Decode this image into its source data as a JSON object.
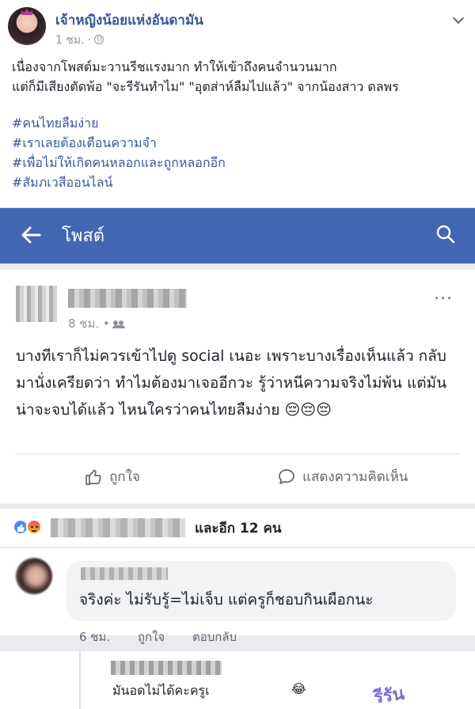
{
  "outer_post": {
    "author": "เจ้าหญิงน้อยแห่งอันดามัน",
    "time": "1 ชม.",
    "dot": "·",
    "privacy_icon": "globe-icon",
    "text_line1": "เนื่องจากโพสต์มะวานรีชแรงมาก ทำให้เข้าถึงคนจำนวนมาก",
    "text_line2": "แต่ก็มีเสียงตัดพ้อ \"จะรีรันทำไม\" \"อุตส่าห์ลืมไปแล้ว\" จากน้องสาว ดลพร",
    "hashtags": [
      "#คนไทยลืมง่าย",
      "#เราเลยต้องเตือนความจำ",
      "#เพื่อไม่ให้เกิดคนหลอกและถูกหลอกอีก",
      "#สัมภเวสีออนไลน์"
    ]
  },
  "appbar": {
    "title": "โพสต์",
    "back_icon": "back-arrow-icon",
    "search_icon": "search-icon",
    "color": "#4267b2"
  },
  "inner_post": {
    "time": "8 ชม. •",
    "more": "...",
    "body": "บางทีเราก็ไม่ควรเข้าไปดู social เนอะ เพราะบางเรื่องเห็นแล้ว กลับมานั่งเครียดว่า ทำไมต้องมาเจออีกวะ รู้ว่าหนีความจริงไม่พ้น แต่มันน่าจะจบได้แล้ว ไหนใครว่าคนไทยลืมง่าย 😔😔😔",
    "like_label": "ถูกใจ",
    "comment_label": "แสดงความคิดเห็น"
  },
  "reactions": {
    "others": "และอีก 12 คน"
  },
  "comment1": {
    "text": "จริงค่ะ ไม่รับรู้=ไม่เจ็บ แต่ครูก็ชอบกินเผือกนะ",
    "time": "6 ชม.",
    "like": "ถูกใจ",
    "reply": "ตอบกลับ"
  },
  "comment2": {
    "text": "มันอดไม่ได้คะครูเ",
    "emoji": "😂",
    "watermark": "รีรัน"
  }
}
